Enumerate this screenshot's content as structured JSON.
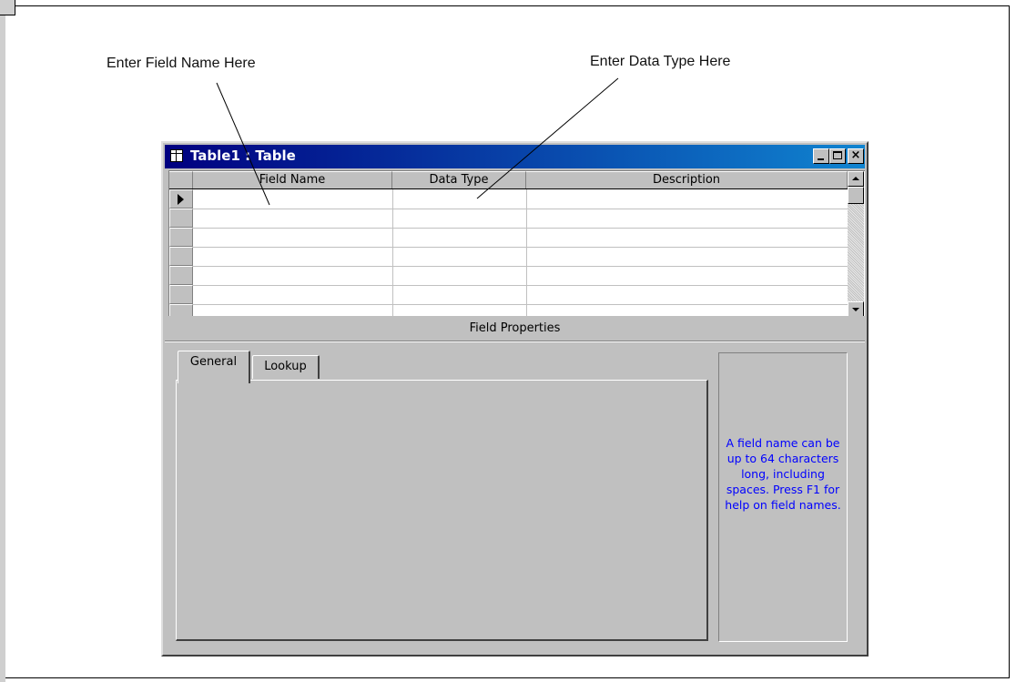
{
  "callouts": {
    "field_name": "Enter Field Name Here",
    "data_type": "Enter Data Type Here"
  },
  "window": {
    "title": "Table1 : Table",
    "icon": "table-icon",
    "controls": {
      "minimize": "minimize-icon",
      "maximize": "maximize-icon",
      "close": "×"
    }
  },
  "grid": {
    "columns": [
      "Field Name",
      "Data Type",
      "Description"
    ],
    "rows": [
      {
        "field_name": "",
        "data_type": "",
        "description": "",
        "current": true
      },
      {
        "field_name": "",
        "data_type": "",
        "description": "",
        "current": false
      },
      {
        "field_name": "",
        "data_type": "",
        "description": "",
        "current": false
      },
      {
        "field_name": "",
        "data_type": "",
        "description": "",
        "current": false
      },
      {
        "field_name": "",
        "data_type": "",
        "description": "",
        "current": false
      },
      {
        "field_name": "",
        "data_type": "",
        "description": "",
        "current": false
      }
    ]
  },
  "field_properties": {
    "label": "Field Properties",
    "tabs": [
      "General",
      "Lookup"
    ],
    "active_tab": "General",
    "help_text": "A field name can be up to 64 characters long, including spaces.  Press F1 for help on field names."
  },
  "colors": {
    "title_bar": "#000080",
    "help_text": "#0000ff",
    "window_face": "#c0c0c0"
  }
}
